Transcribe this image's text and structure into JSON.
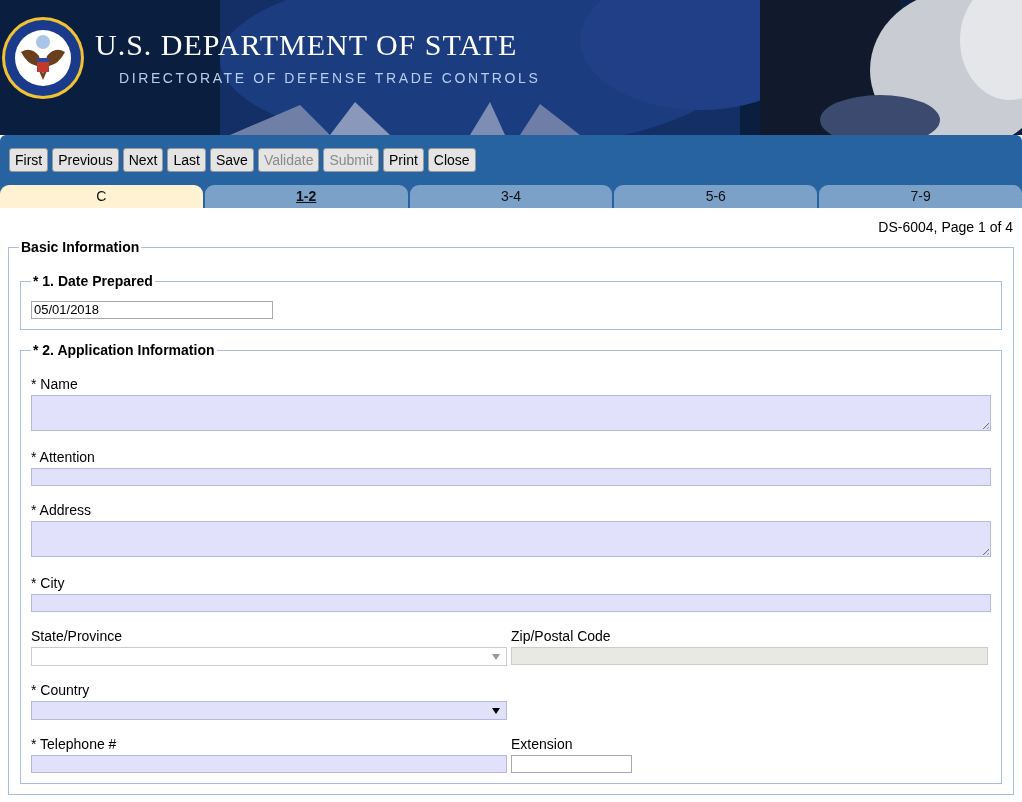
{
  "header": {
    "title": "U.S. DEPARTMENT OF STATE",
    "subtitle": "DIRECTORATE OF DEFENSE TRADE CONTROLS"
  },
  "toolbar": [
    {
      "label": "First",
      "disabled": false
    },
    {
      "label": "Previous",
      "disabled": false
    },
    {
      "label": "Next",
      "disabled": false
    },
    {
      "label": "Last",
      "disabled": false
    },
    {
      "label": "Save",
      "disabled": false
    },
    {
      "label": "Validate",
      "disabled": true
    },
    {
      "label": "Submit",
      "disabled": true
    },
    {
      "label": "Print",
      "disabled": false
    },
    {
      "label": "Close",
      "disabled": false
    }
  ],
  "tabs": [
    {
      "label": "C",
      "selected": true,
      "current": false
    },
    {
      "label": "1-2",
      "selected": false,
      "current": true
    },
    {
      "label": "3-4",
      "selected": false,
      "current": false
    },
    {
      "label": "5-6",
      "selected": false,
      "current": false
    },
    {
      "label": "7-9",
      "selected": false,
      "current": false
    }
  ],
  "page_info": "DS-6004, Page 1 of 4",
  "form": {
    "legend": "Basic Information",
    "sections": [
      {
        "legend": "* 1. Date Prepared",
        "rows": [
          [
            {
              "kind": "short-text",
              "value": "05/01/2018",
              "required": false
            }
          ]
        ]
      },
      {
        "legend": "* 2. Application Information",
        "rows": [
          [
            {
              "kind": "textarea",
              "label": "* Name",
              "required": true
            }
          ],
          [
            {
              "kind": "text",
              "label": "* Attention",
              "required": true
            }
          ],
          [
            {
              "kind": "textarea",
              "label": "* Address",
              "required": true
            }
          ],
          [
            {
              "kind": "text",
              "label": "* City",
              "required": true
            }
          ],
          [
            {
              "kind": "select",
              "label": "State/Province",
              "disabled": true
            },
            {
              "kind": "text",
              "label": "Zip/Postal Code",
              "disabled": true
            }
          ],
          [
            {
              "kind": "select",
              "label": "* Country",
              "required": true
            }
          ],
          [
            {
              "kind": "text",
              "label": "* Telephone #",
              "required": true
            },
            {
              "kind": "short-text",
              "label": "Extension",
              "required": false
            }
          ]
        ]
      }
    ]
  }
}
